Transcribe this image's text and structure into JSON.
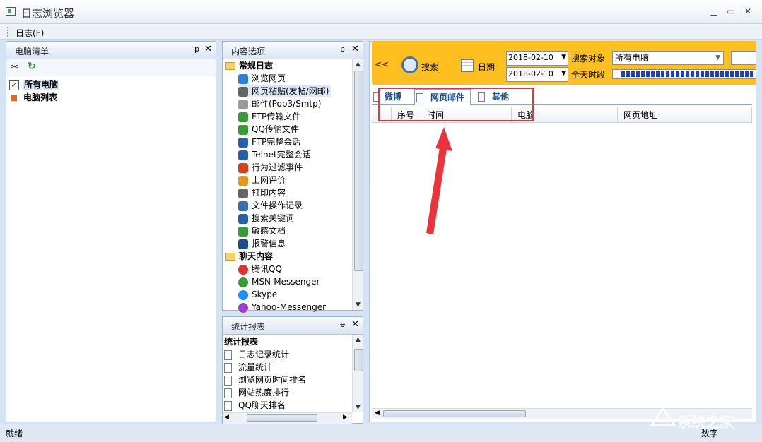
{
  "window": {
    "title": "日志浏览器",
    "minimize": "▁",
    "maximize": "▭",
    "close": "✕"
  },
  "menu": {
    "log": "日志(F)"
  },
  "computer_panel": {
    "title": "电脑清单",
    "pin": "ᵽ",
    "close": "✕",
    "items": [
      {
        "label": "所有电脑",
        "checked": true
      },
      {
        "label": "电脑列表"
      }
    ]
  },
  "content_panel": {
    "title": "内容选项",
    "pin": "ᵽ",
    "close": "✕",
    "group1": "常规日志",
    "items1": [
      "浏览网页",
      "网页粘贴(发帖/网邮)",
      "邮件(Pop3/Smtp)",
      "FTP传输文件",
      "QQ传输文件",
      "FTP完整会话",
      "Telnet完整会话",
      "行为过滤事件",
      "上网评价",
      "打印内容",
      "文件操作记录",
      "搜索关键词",
      "敏感文档",
      "报警信息"
    ],
    "group2": "聊天内容",
    "items2": [
      "腾讯QQ",
      "MSN-Messenger",
      "Skype",
      "Yahoo-Messenger"
    ]
  },
  "stats_panel": {
    "title": "统计报表",
    "pin": "ᵽ",
    "close": "✕",
    "group": "统计报表",
    "items": [
      "日志记录统计",
      "流量统计",
      "浏览网页时间排名",
      "网站热度排行",
      "QQ聊天排名"
    ]
  },
  "toolbar": {
    "collapse": "<<",
    "search_label": "搜索",
    "date_label": "日期",
    "date_from": "2018-02-10",
    "date_to": "2018-02-10",
    "search_target_label": "搜索对象",
    "search_target_value": "所有电脑",
    "all_day_label": "全天时段"
  },
  "tabs": [
    "微博",
    "网页邮件",
    "其他"
  ],
  "table_headers": [
    "序号",
    "时间",
    "电脑",
    "网页地址"
  ],
  "status": {
    "left": "就绪",
    "right": "数字"
  },
  "watermark": "系统之家",
  "colors": {
    "toolbar": "#fdc020",
    "annotation": "#e8343a",
    "selection": "#dce8f7"
  }
}
